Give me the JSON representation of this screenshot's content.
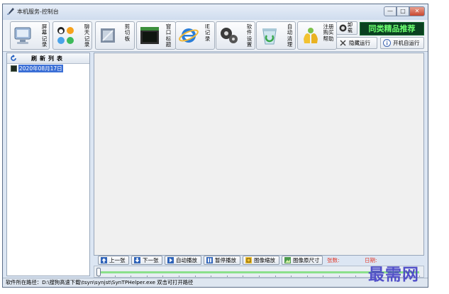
{
  "window": {
    "title": "本机服务-控制台",
    "min": "—",
    "max": "□",
    "close": "✕"
  },
  "toolbar": {
    "screen_record": "屏幕记录",
    "chat_record": "聊天记录",
    "clipboard": "剪切板",
    "window_title": "窗口标题",
    "ie_record": "IE记录",
    "software_settings": "软件设置",
    "auto_clean": "自动清理",
    "register_help": "注册购买帮助",
    "uninstall": "卸载",
    "promo": "同类精品推荐",
    "hidden_run": "隐藏运行",
    "startup_run": "开机自运行"
  },
  "left_panel": {
    "refresh_label": "刷新列表",
    "tree_item": "2020年08月17日"
  },
  "controls": {
    "prev": "上一张",
    "next": "下一张",
    "auto_play": "自动播放",
    "pause": "暂停播放",
    "zoom": "图像缩放",
    "original": "图像原尺寸",
    "count_label": "张数:",
    "date_label": "日期:"
  },
  "slider": {
    "position": 0.0
  },
  "status_bar": {
    "path": "软件所在路径：D:\\搜狗高速下载\\tsyn\\synjst\\SynTPHelper.exe 双击可打开路径"
  },
  "watermark": {
    "text": "最需网"
  },
  "colors": {
    "promo_bg": "#0a4020",
    "promo_text": "#6dff70",
    "tree_highlight": "#3b6fd6",
    "red_label": "#e23b2b",
    "watermark": "#4b49c7"
  }
}
